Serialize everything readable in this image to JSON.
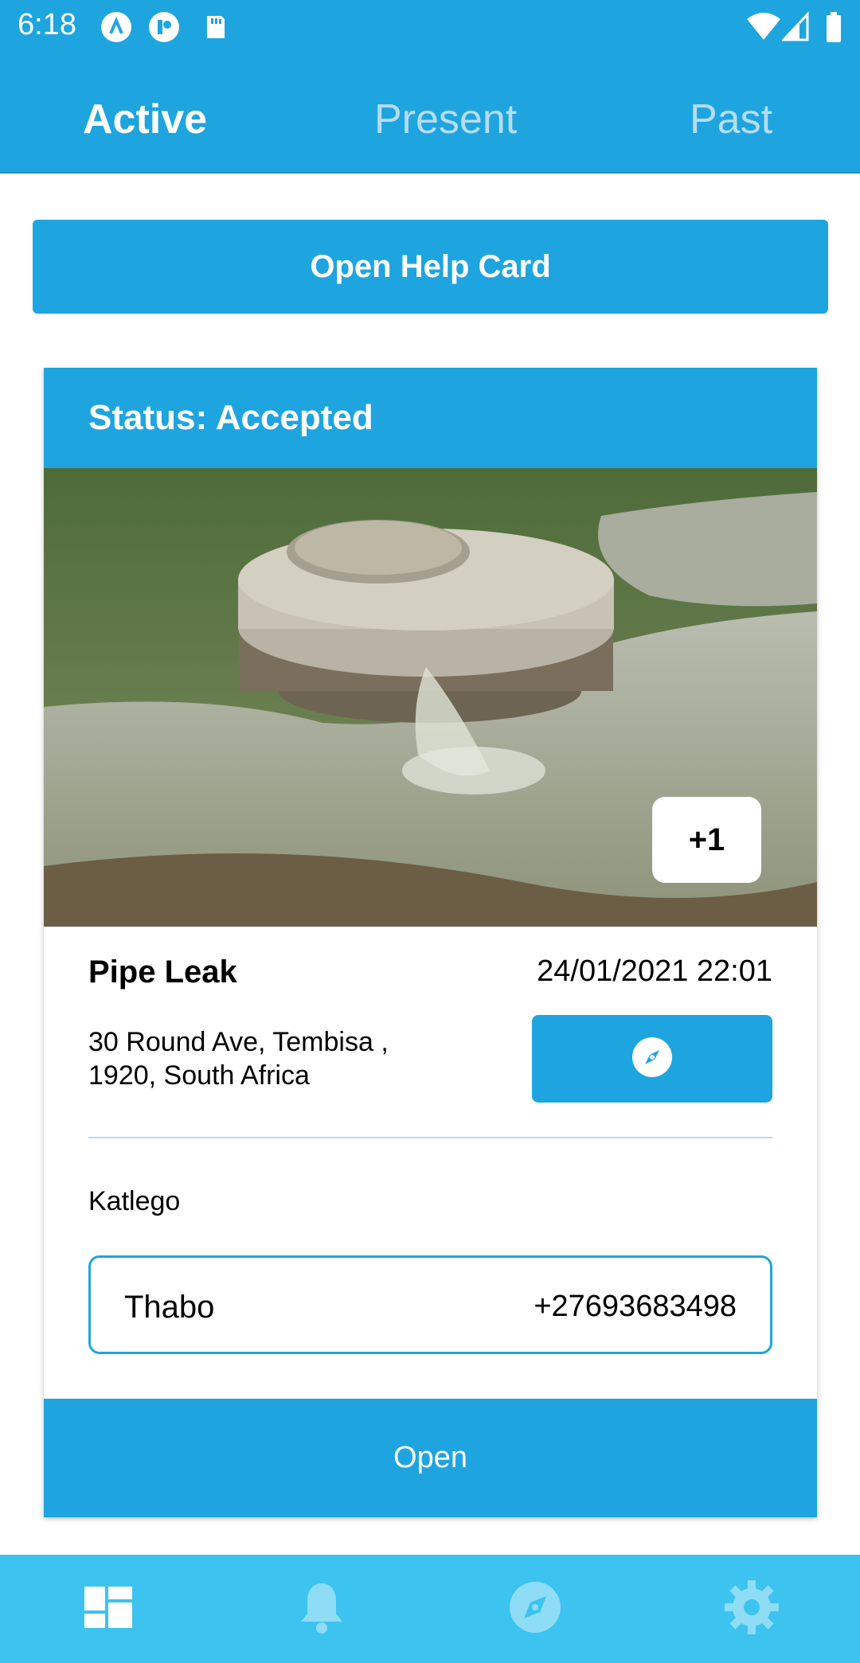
{
  "status_bar": {
    "time": "6:18",
    "left_icons": [
      "app-a-icon",
      "app-p-icon",
      "sd-card-icon"
    ],
    "right_icons": [
      "wifi-icon",
      "signal-icon",
      "battery-icon"
    ]
  },
  "tabs": [
    {
      "label": "Active",
      "active": true
    },
    {
      "label": "Present",
      "active": false
    },
    {
      "label": "Past",
      "active": false
    }
  ],
  "help_button": {
    "label": "Open Help Card"
  },
  "card": {
    "status": "Status: Accepted",
    "photo_badge": "+1",
    "incident_title": "Pipe Leak",
    "datetime": "24/01/2021 22:01",
    "address_line1": "30 Round Ave, Tembisa ,",
    "address_line2": "1920, South Africa",
    "navigate_icon": "compass-icon",
    "reporter": "Katlego",
    "contact_name": "Thabo",
    "contact_phone": "+27693683498",
    "open_label": "Open"
  },
  "bottom_nav": [
    {
      "icon": "dashboard-icon"
    },
    {
      "icon": "bell-icon"
    },
    {
      "icon": "compass-icon"
    },
    {
      "icon": "gear-icon"
    }
  ],
  "colors": {
    "primary": "#1ea5df",
    "bottom_nav": "#3cc3ef",
    "inactive_tab": "#b6dcf2"
  }
}
